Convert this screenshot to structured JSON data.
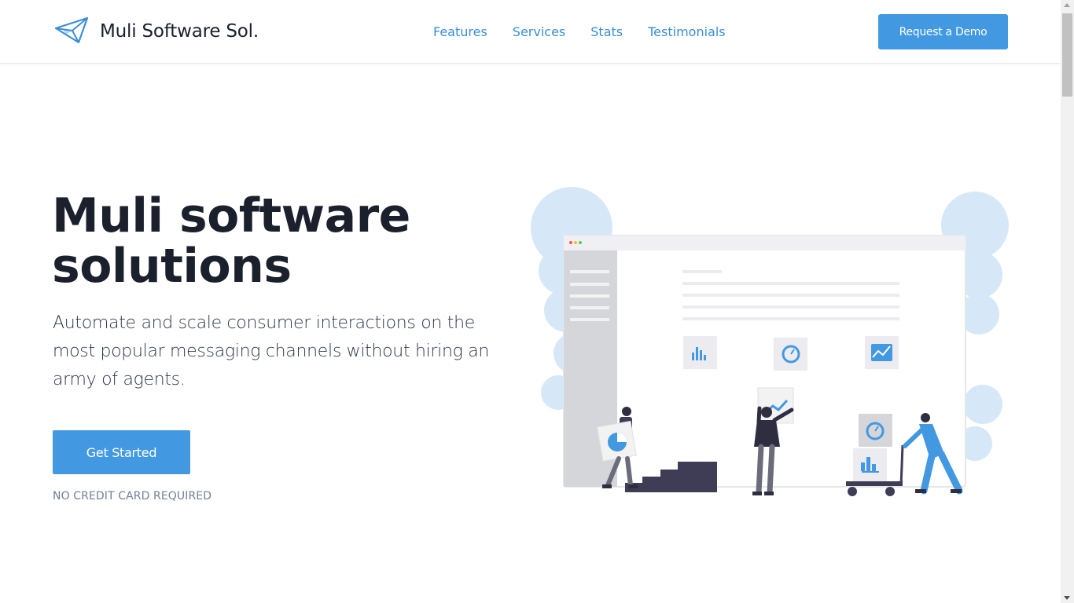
{
  "header": {
    "brand": "Muli Software Sol.",
    "logo_icon": "paper-plane-icon",
    "nav": [
      {
        "label": "Features"
      },
      {
        "label": "Services"
      },
      {
        "label": "Stats"
      },
      {
        "label": "Testimonials"
      }
    ],
    "demo_button": "Request a Demo"
  },
  "hero": {
    "title_line1": "Muli software",
    "title_line2": "solutions",
    "subtitle": "Automate and scale consumer interactions on the most popular messaging channels without hiring an army of agents.",
    "cta": "Get Started",
    "note": "NO CREDIT CARD REQUIRED",
    "illustration_icon": "dashboard-team-illustration"
  },
  "colors": {
    "accent": "#4299e1",
    "nav_link": "#3b8ed6",
    "heading": "#1a202c",
    "muted": "#718096",
    "illustration_light": "#d6e8f7",
    "illustration_dark": "#3f3d56"
  }
}
